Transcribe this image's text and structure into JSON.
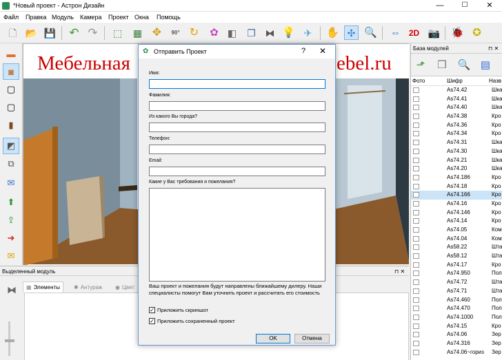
{
  "window": {
    "title": "*Новый проект - Астрон Дизайн",
    "minimize": "—",
    "maximize": "☐",
    "close": "✕"
  },
  "menu": [
    "Файл",
    "Правка",
    "Модуль",
    "Камера",
    "Проект",
    "Окна",
    "Помощь"
  ],
  "toolbar": {
    "icons": [
      "new-file-icon",
      "open-folder-icon",
      "save-icon",
      "undo-icon",
      "redo-icon",
      "select-icon",
      "group-icon",
      "move-icon",
      "rotate-90-icon",
      "rotate-icon",
      "texture-icon",
      "mirror-icon",
      "duplicate-icon",
      "flip-icon",
      "light-icon",
      "camera-fly-icon",
      "hand-icon",
      "orbit-icon",
      "zoom-icon",
      "dimension-icon",
      "view-2d-icon",
      "screenshot-icon",
      "bug-icon",
      "wizard-icon"
    ],
    "view_2d_label": "2D",
    "rotate_label": "90°"
  },
  "viewport": {
    "banner_left": "Мебельная",
    "banner_right": "ebel.ru"
  },
  "right_panel": {
    "title": "База модулей",
    "pin": "⊓ ✕",
    "columns": {
      "photo": "Фото",
      "code": "Шифр",
      "name": "Назв"
    },
    "rows": [
      {
        "code": "As74.42",
        "name": "Шка"
      },
      {
        "code": "As74.41",
        "name": "Шка"
      },
      {
        "code": "As74.40",
        "name": "Шка"
      },
      {
        "code": "As74.38",
        "name": "Кро"
      },
      {
        "code": "As74.36",
        "name": "Кро"
      },
      {
        "code": "As74.34",
        "name": "Кро"
      },
      {
        "code": "As74.31",
        "name": "Шка"
      },
      {
        "code": "As74.30",
        "name": "Шка"
      },
      {
        "code": "As74.21",
        "name": "Шка"
      },
      {
        "code": "As74.20",
        "name": "Шка"
      },
      {
        "code": "As74.186",
        "name": "Кро"
      },
      {
        "code": "As74.18",
        "name": "Кро"
      },
      {
        "code": "As74.166",
        "name": "Кро"
      },
      {
        "code": "As74.16",
        "name": "Кро"
      },
      {
        "code": "As74.146",
        "name": "Кро"
      },
      {
        "code": "As74.14",
        "name": "Кро"
      },
      {
        "code": "As74.05",
        "name": "Ком"
      },
      {
        "code": "As74.04",
        "name": "Ком"
      },
      {
        "code": "As58.22",
        "name": "Шта"
      },
      {
        "code": "As58.12",
        "name": "Шта"
      },
      {
        "code": "As74.17",
        "name": "Кро"
      },
      {
        "code": "As74.950",
        "name": "Пол"
      },
      {
        "code": "As74.72",
        "name": "Шта"
      },
      {
        "code": "As74.71",
        "name": "Шта"
      },
      {
        "code": "As74.460",
        "name": "Пол"
      },
      {
        "code": "As74.470",
        "name": "Пол"
      },
      {
        "code": "As74.1000",
        "name": "Пол"
      },
      {
        "code": "As74.15",
        "name": "Кро"
      },
      {
        "code": "As74.06",
        "name": "Зер"
      },
      {
        "code": "As74.316",
        "name": "Зер"
      },
      {
        "code": "As74.06~гориз",
        "name": "Зер"
      }
    ]
  },
  "bottom_panel": {
    "title": "Выделенный модуль",
    "pin": "⊓ ✕",
    "tabs": [
      "Элементы",
      "Антураж",
      "Цвет"
    ]
  },
  "dialog": {
    "title": "Отправить Проект",
    "help": "?",
    "close": "✕",
    "fields": {
      "name_label": "Имя:",
      "surname_label": "Фамилия:",
      "city_label": "Из какого Вы города?",
      "phone_label": "Телефон:",
      "email_label": "Email:",
      "wishes_label": "Какие у Вас требования и пожелания?"
    },
    "note": "Ваш проект и пожелания будут направлены ближайшему дилеру. Наши специалисты помогут Вам уточнить проект и рассчитать его стоимость",
    "attach_screenshot": "Приложить скриншот",
    "attach_project": "Приложить сохраненный проект",
    "check_mark": "✓",
    "ok": "OK",
    "cancel": "Отмена"
  }
}
